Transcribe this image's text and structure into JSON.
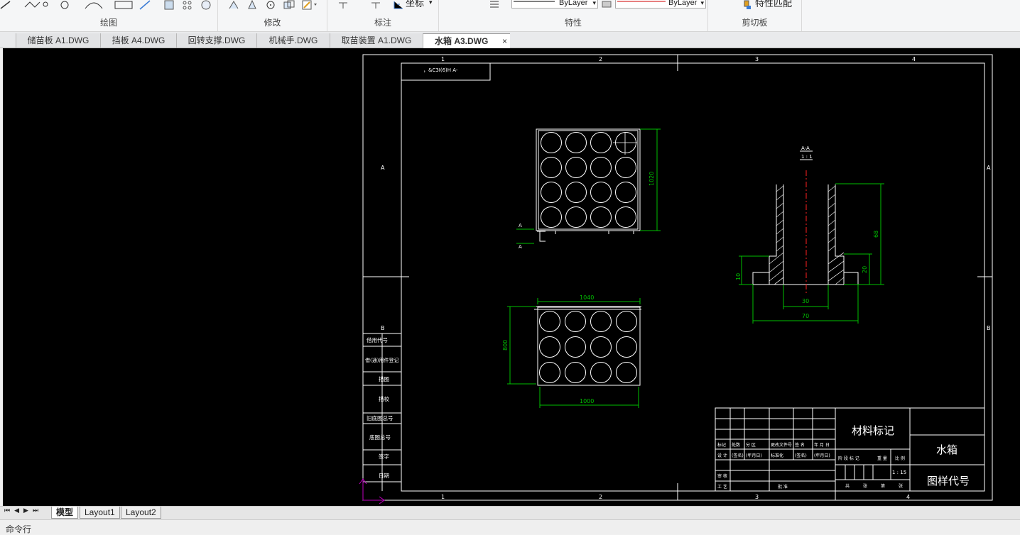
{
  "ribbon": {
    "groups": [
      {
        "label": "绘图"
      },
      {
        "label": "修改"
      },
      {
        "label": "标注"
      },
      {
        "label": "特性"
      },
      {
        "label": "剪切板"
      }
    ],
    "dim_coord_label": "坐标",
    "linetype_value": "ByLayer",
    "color_value": "ByLayer",
    "match_properties_label": "特性匹配"
  },
  "tabs": [
    {
      "label": "储苗板 A1.DWG"
    },
    {
      "label": "挡板 A4.DWG"
    },
    {
      "label": "回转支撑.DWG"
    },
    {
      "label": "机械手.DWG"
    },
    {
      "label": "取苗装置 A1.DWG"
    },
    {
      "label": "水箱 A3.DWG",
      "active": true,
      "close": "×"
    }
  ],
  "drawing": {
    "border_cols": [
      "1",
      "2",
      "3",
      "4"
    ],
    "border_rows": [
      "A",
      "B"
    ],
    "stamp_text": "，&C3I(6)H  A-",
    "left_strip": [
      "借用代号",
      "借(通)用件登记",
      "描图",
      "描校",
      "旧底图总号",
      "底图总号",
      "签字",
      "日期"
    ],
    "dims": {
      "top_view_height": "1020",
      "bottom_view_top": "1040",
      "bottom_view_side": "800",
      "bottom_view_bottom": "1000",
      "section_label": "A-A",
      "section_scale": "1 : 1",
      "section_height": "68",
      "section_inner": "30",
      "section_outer": "70",
      "section_left": "10",
      "section_right": "20"
    },
    "section_marker": "A",
    "title_block": {
      "material": "材料标记",
      "name": "水箱",
      "drawing_no": "图样代号",
      "scale": "1 : 15",
      "header_row": [
        "标记",
        "处数",
        "分 区",
        "更改文件号",
        "签 名",
        "年 月 日"
      ],
      "row2": [
        "设 计",
        "(签名)",
        "(年月日)",
        "标准化",
        "(签名)",
        "(年月日)"
      ],
      "row3": [
        "审 核"
      ],
      "row4": [
        "工 艺",
        "批 准"
      ],
      "stage": [
        "阶 段 标 记",
        "重 量",
        "比 例"
      ],
      "footer": [
        "共",
        "张",
        "第",
        "张"
      ]
    }
  },
  "layout_tabs": [
    {
      "label": "模型",
      "active": true
    },
    {
      "label": "Layout1"
    },
    {
      "label": "Layout2"
    }
  ],
  "command_label": "命令行",
  "colors": {
    "canvas": "#000000",
    "dim_line": "#00c000",
    "center_line": "#ff0000",
    "ucs": "#c000c0"
  }
}
